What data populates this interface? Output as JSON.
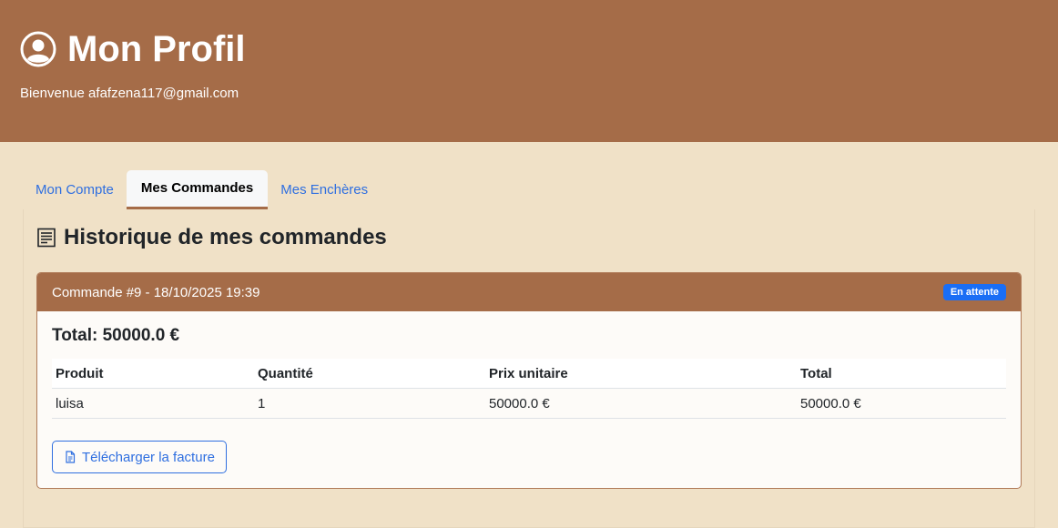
{
  "header": {
    "title": "Mon Profil",
    "welcome": "Bienvenue afafzena117@gmail.com",
    "icon": "user-circle-icon"
  },
  "tabs": [
    {
      "label": "Mon Compte",
      "active": false
    },
    {
      "label": "Mes Commandes",
      "active": true
    },
    {
      "label": "Mes Enchères",
      "active": false
    }
  ],
  "section": {
    "title": "Historique de mes commandes",
    "icon": "receipt-icon"
  },
  "order": {
    "header": "Commande #9 - 18/10/2025 19:39",
    "status": "En attente",
    "total": "Total: 50000.0 €",
    "columns": [
      "Produit",
      "Quantité",
      "Prix unitaire",
      "Total"
    ],
    "rows": [
      [
        "luisa",
        "1",
        "50000.0 €",
        "50000.0 €"
      ]
    ],
    "download_label": "Télécharger la facture"
  },
  "colors": {
    "header_bg": "#a56c48",
    "page_bg": "#f0e1c7",
    "link": "#2f6fe0",
    "badge": "#1a6ef5"
  }
}
